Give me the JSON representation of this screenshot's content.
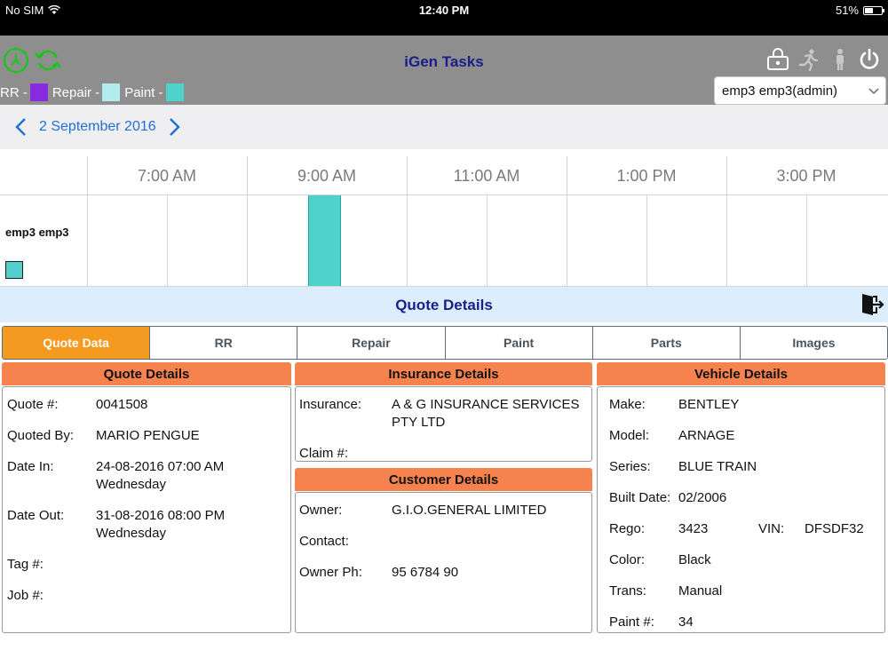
{
  "status": {
    "carrier": "No SIM",
    "time": "12:40 PM",
    "battery": "51%",
    "battery_level": 0.51
  },
  "header": {
    "title": "iGen Tasks",
    "legend": [
      {
        "label": "RR -",
        "color": "#8a2be2"
      },
      {
        "label": "Repair -",
        "color": "#b3ecec"
      },
      {
        "label": "Paint -",
        "color": "#4fd1cc"
      }
    ],
    "user_selected": "emp3 emp3(admin)"
  },
  "date_nav": {
    "date": "2 September 2016"
  },
  "schedule": {
    "hours": [
      "7:00 AM",
      "9:00 AM",
      "11:00 AM",
      "1:00 PM",
      "3:00 PM"
    ],
    "employee": "emp3 emp3",
    "task_color": "#4fd1cc"
  },
  "quote_bar": {
    "title": "Quote Details"
  },
  "tabs": [
    {
      "label": "Quote Data",
      "active": true
    },
    {
      "label": "RR"
    },
    {
      "label": "Repair"
    },
    {
      "label": "Paint"
    },
    {
      "label": "Parts"
    },
    {
      "label": "Images"
    }
  ],
  "quote_details": {
    "title": "Quote Details",
    "fields": [
      {
        "k": "Quote #:",
        "v": "0041508"
      },
      {
        "k": "Quoted By:",
        "v": "MARIO PENGUE"
      },
      {
        "k": "Date In:",
        "v": "24-08-2016 07:00 AM",
        "v2": "Wednesday"
      },
      {
        "k": "Date Out:",
        "v": "31-08-2016 08:00 PM",
        "v2": "Wednesday"
      },
      {
        "k": "Tag #:",
        "v": ""
      },
      {
        "k": "Job #:",
        "v": ""
      }
    ]
  },
  "insurance_details": {
    "title": "Insurance Details",
    "fields": [
      {
        "k": "Insurance:",
        "v": "A & G INSURANCE SERVICES",
        "v2": "PTY LTD"
      },
      {
        "k": "Claim #:",
        "v": ""
      }
    ]
  },
  "customer_details": {
    "title": "Customer Details",
    "fields": [
      {
        "k": "Owner:",
        "v": "G.I.O.GENERAL LIMITED"
      },
      {
        "k": "Contact:",
        "v": ""
      },
      {
        "k": "Owner Ph:",
        "v": "95 6784 90"
      }
    ]
  },
  "vehicle_details": {
    "title": "Vehicle Details",
    "fields": [
      {
        "k": "Make:",
        "v": "BENTLEY"
      },
      {
        "k": "Model:",
        "v": "ARNAGE"
      },
      {
        "k": "Series:",
        "v": "BLUE TRAIN"
      },
      {
        "k": "Built Date:",
        "v": "02/2006"
      },
      {
        "k": "Rego:",
        "v": "3423",
        "k2": "VIN:",
        "v2": "DFSDF32"
      },
      {
        "k": "Color:",
        "v": "Black"
      },
      {
        "k": "Trans:",
        "v": "Manual"
      },
      {
        "k": "Paint #:",
        "v": "34"
      }
    ]
  },
  "colors": {
    "accent_tab": "#f49a20",
    "panel_header": "#f6824e",
    "title_blue": "#1a1d8a",
    "link_blue": "#1f6fd6"
  }
}
